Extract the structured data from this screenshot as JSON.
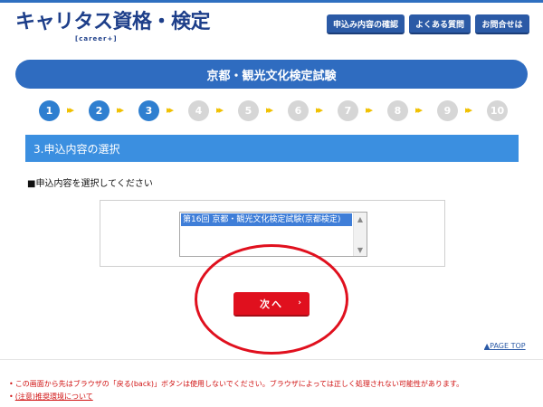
{
  "header": {
    "logo_main": "キャリタス資格・検定",
    "logo_sub": "[career+]",
    "nav": [
      {
        "label": "申込み内容の確認"
      },
      {
        "label": "よくある質問"
      },
      {
        "label": "お問合せは"
      }
    ]
  },
  "banner": {
    "title": "京都・観光文化検定試験"
  },
  "steps": {
    "items": [
      "1",
      "2",
      "3",
      "4",
      "5",
      "6",
      "7",
      "8",
      "9",
      "10"
    ],
    "current": 3,
    "arrow_glyph": "▸▸",
    "active_color": "#2f7fd0",
    "inactive_color": "#d6d6d6"
  },
  "section": {
    "title": "3.申込内容の選択"
  },
  "instruction": "■申込内容を選択してください",
  "listbox": {
    "selected_option": "第16回 京都・観光文化検定試験(京都検定)"
  },
  "next_button": {
    "label": "次へ",
    "chevron": "›"
  },
  "page_top": "▲PAGE TOP",
  "notes": [
    {
      "text": "この画面から先はブラウザの「戻る(back)」ボタンは使用しないでください。ブラウザによっては正しく処理されない可能性があります。"
    },
    {
      "text": "(注意)推奨環境について"
    }
  ],
  "colors": {
    "brand_blue": "#2b5aa6",
    "banner_blue": "#2f6cc0",
    "section_blue": "#3b8fe0",
    "accent_red": "#e0101e",
    "step_arrow": "#f0c000"
  }
}
